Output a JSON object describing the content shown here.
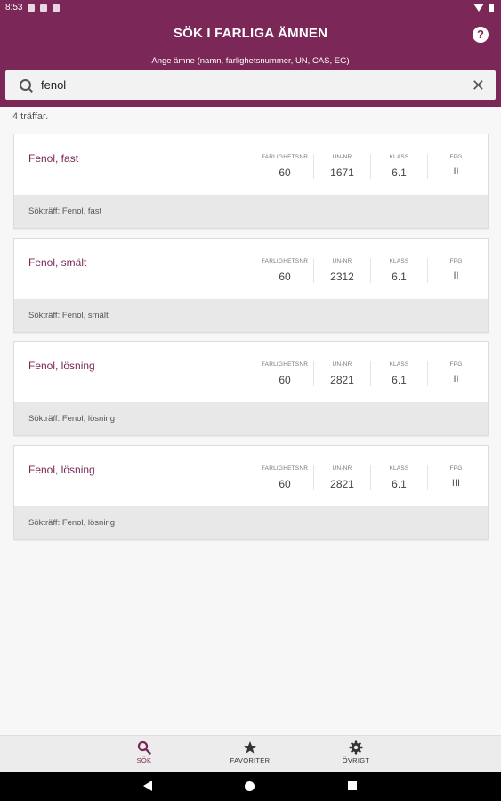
{
  "status_bar": {
    "time": "8:53"
  },
  "header": {
    "title": "SÖK I FARLIGA ÄMNEN",
    "subtitle": "Ange ämne (namn, farlighetsnummer, UN, CAS, EG)",
    "help_icon": "question-circle-icon"
  },
  "search": {
    "value": "fenol",
    "search_icon": "search-icon",
    "clear_icon": "close-icon"
  },
  "hits_text": "4 träffar.",
  "columns": {
    "farlighetsnr": "FARLIGHETSNR",
    "un_nr": "UN-NR",
    "klass": "KLASS",
    "fpg": "FPG"
  },
  "results": [
    {
      "name": "Fenol, fast",
      "farlighetsnr": "60",
      "un_nr": "1671",
      "klass": "6.1",
      "fpg": "II",
      "match": "Sökträff: Fenol, fast"
    },
    {
      "name": "Fenol, smält",
      "farlighetsnr": "60",
      "un_nr": "2312",
      "klass": "6.1",
      "fpg": "II",
      "match": "Sökträff: Fenol, smält"
    },
    {
      "name": "Fenol, lösning",
      "farlighetsnr": "60",
      "un_nr": "2821",
      "klass": "6.1",
      "fpg": "II",
      "match": "Sökträff: Fenol, lösning"
    },
    {
      "name": "Fenol, lösning",
      "farlighetsnr": "60",
      "un_nr": "2821",
      "klass": "6.1",
      "fpg": "III",
      "match": "Sökträff: Fenol, lösning"
    }
  ],
  "bottom_nav": [
    {
      "label": "SÖK",
      "icon": "search-icon",
      "active": true
    },
    {
      "label": "FAVORITER",
      "icon": "star-icon",
      "active": false
    },
    {
      "label": "ÖVRIGT",
      "icon": "gear-icon",
      "active": false
    }
  ],
  "colors": {
    "brand": "#7b2757",
    "card_footer": "#e8e8e8"
  }
}
